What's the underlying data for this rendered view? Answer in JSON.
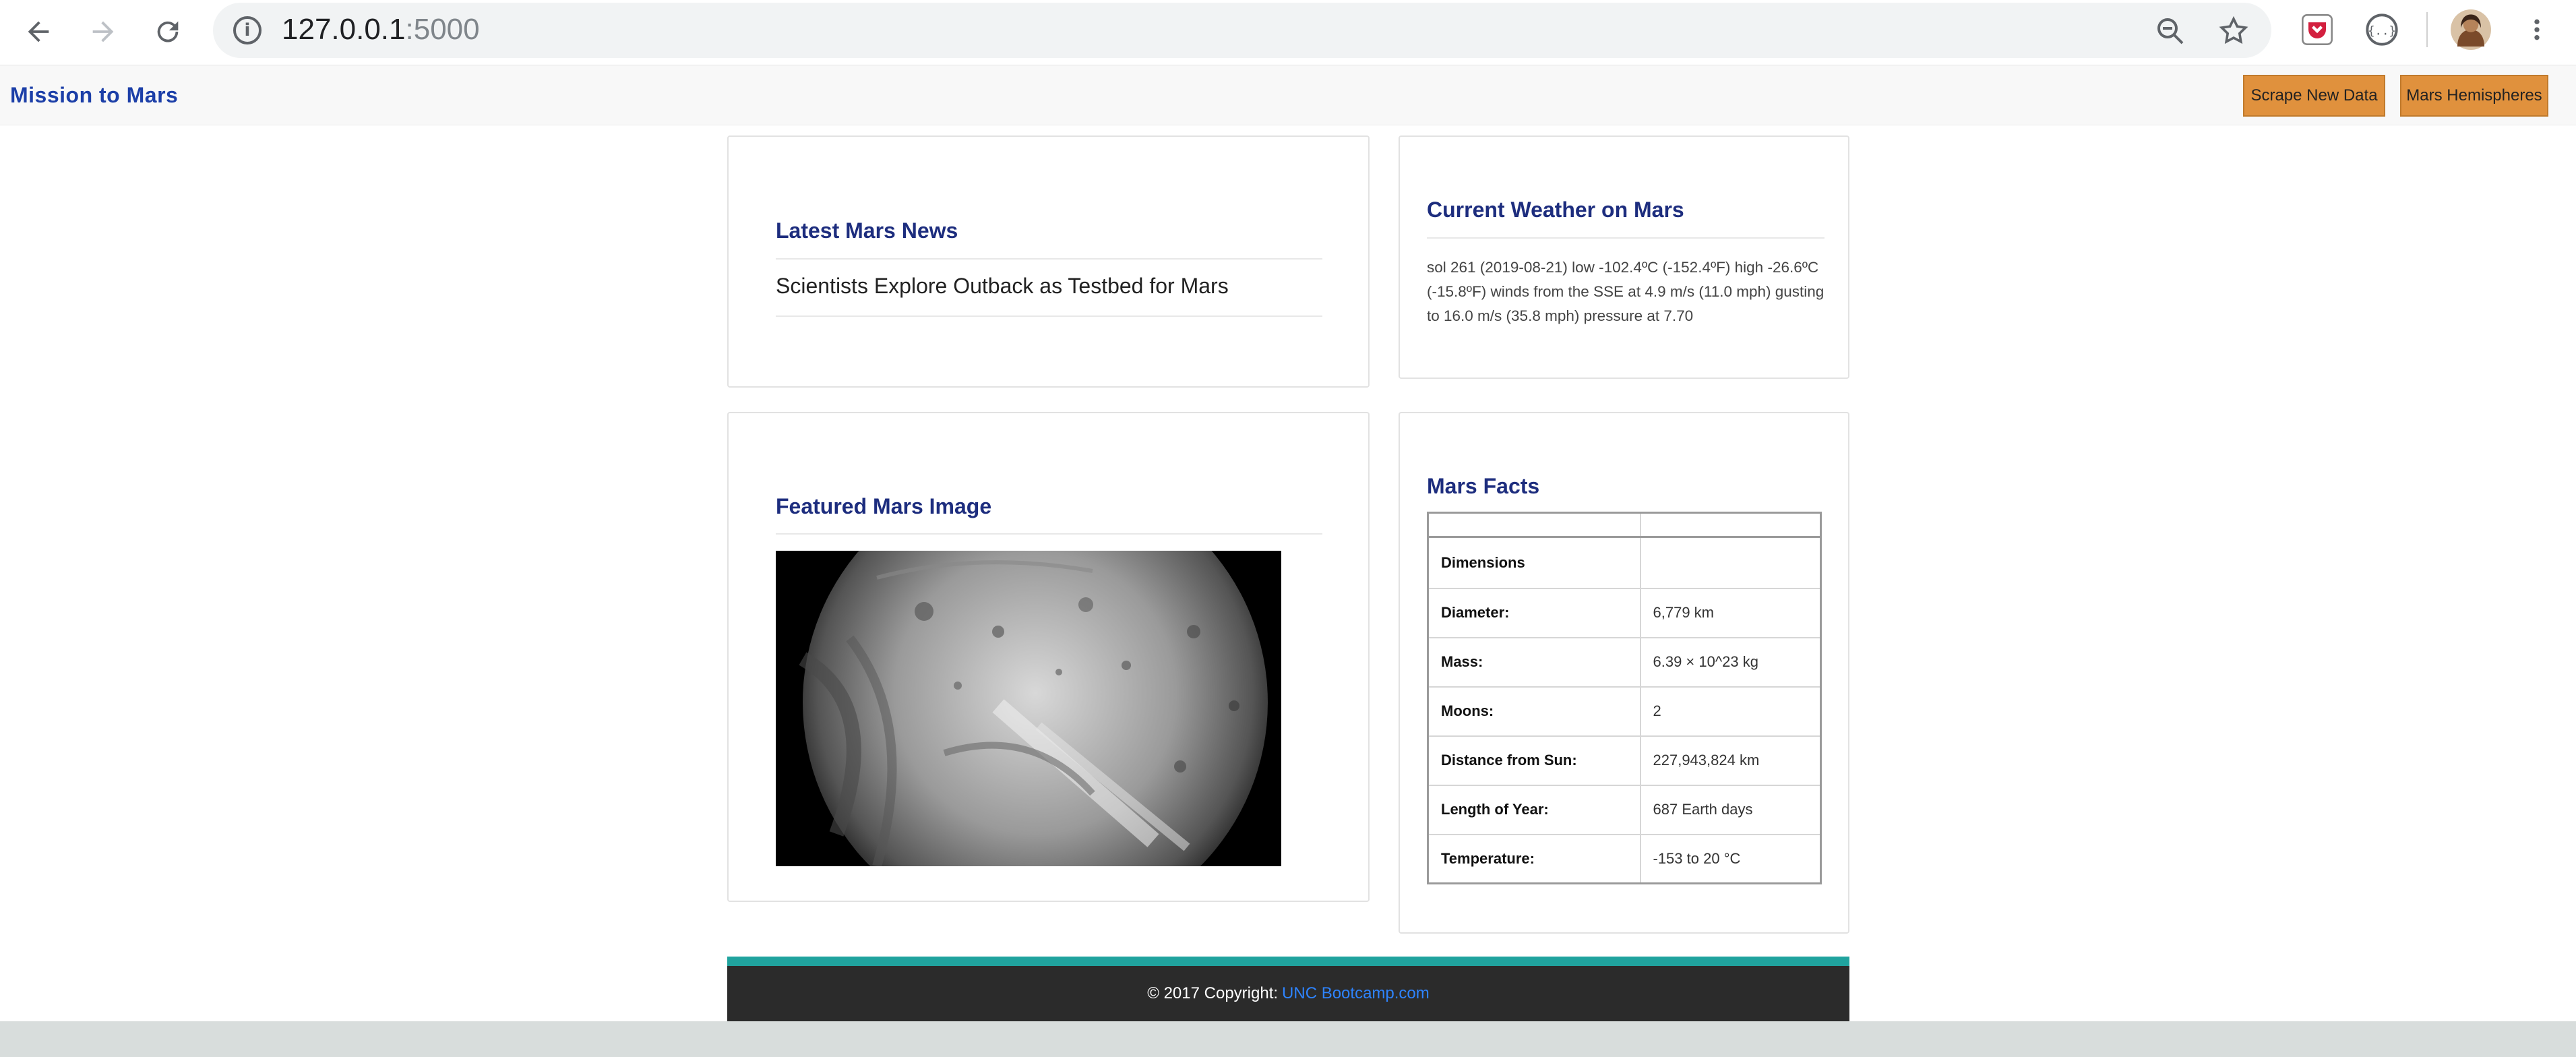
{
  "browser": {
    "url_host": "127.0.0.1",
    "url_port": ":5000",
    "icons": [
      "back-arrow-icon",
      "forward-arrow-icon",
      "reload-icon",
      "info-icon",
      "zoom-out-icon",
      "bookmark-star-icon",
      "pocket-extension-icon",
      "json-extension-icon",
      "profile-avatar",
      "more-menu-icon"
    ]
  },
  "navbar": {
    "brand": "Mission to Mars",
    "scrape_button": "Scrape New Data",
    "hemispheres_button": "Mars Hemispheres",
    "button_color": "#e0913d",
    "brand_color": "#1c3fa8"
  },
  "news": {
    "heading": "Latest Mars News",
    "title": "Scientists Explore Outback as Testbed for Mars"
  },
  "weather": {
    "heading": "Current Weather on Mars",
    "report": "sol 261 (2019-08-21) low -102.4ºC (-152.4ºF) high -26.6ºC (-15.8ºF) winds from the SSE at 4.9 m/s (11.0 mph) gusting to 16.0 m/s (35.8 mph) pressure at 7.70"
  },
  "featured": {
    "heading": "Featured Mars Image"
  },
  "facts": {
    "heading": "Mars Facts",
    "header_label": "Dimensions",
    "rows": [
      {
        "label": "Diameter:",
        "value": "6,779 km"
      },
      {
        "label": "Mass:",
        "value": "6.39 × 10^23 kg"
      },
      {
        "label": "Moons:",
        "value": "2"
      },
      {
        "label": "Distance from Sun:",
        "value": "227,943,824 km"
      },
      {
        "label": "Length of Year:",
        "value": "687 Earth days"
      },
      {
        "label": "Temperature:",
        "value": "-153 to 20 °C"
      }
    ]
  },
  "footer": {
    "text": "© 2017 Copyright:",
    "link": "UNC Bootcamp.com",
    "accent_color": "#20a39e"
  }
}
